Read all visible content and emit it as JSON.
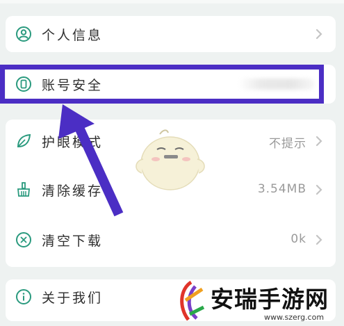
{
  "settings": {
    "items": [
      {
        "label": "个人信息",
        "icon": "person-icon",
        "value": ""
      },
      {
        "label": "账号安全",
        "icon": "phone-icon",
        "value": ""
      },
      {
        "label": "护眼模式",
        "icon": "leaf-icon",
        "value": "不提示"
      },
      {
        "label": "清除缓存",
        "icon": "broom-icon",
        "value": "3.54MB"
      },
      {
        "label": "清空下载",
        "icon": "clear-download-icon",
        "value": "0k"
      },
      {
        "label": "关于我们",
        "icon": "info-icon",
        "value": ""
      }
    ]
  },
  "watermark": {
    "name": "安瑞手游网",
    "url": "www.szerg.com"
  },
  "colors": {
    "accent": "#4b2ec4",
    "icon": "#2a9a7e",
    "background": "#eef2f1"
  }
}
